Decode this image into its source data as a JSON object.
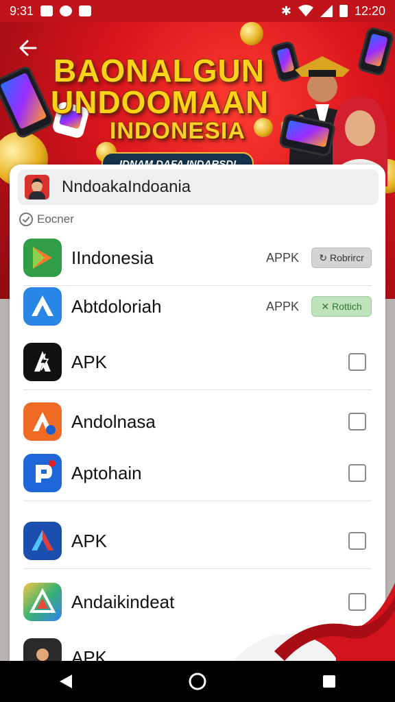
{
  "status_bar": {
    "time": "9:31",
    "clock": "12:20"
  },
  "banner": {
    "title_line1": "BAONALGUN",
    "title_line2": "UNDOOMAAN",
    "title_line3": "INDONESIA",
    "ribbon": "IDNAM DAFA INDARSDI"
  },
  "search": {
    "value": "NndoakaIndoania"
  },
  "section": {
    "label": "Eocner"
  },
  "apps": [
    {
      "name": "IIndonesia",
      "tag": "APPK",
      "action": "Robrircr",
      "action_style": "grey",
      "action_icon": "refresh-icon",
      "icon": "play-store-arrow-icon",
      "icon_color": "#2f9e46"
    },
    {
      "name": "Abtdoloriah",
      "tag": "APPK",
      "action": "Rottich",
      "action_style": "green",
      "action_icon": "close-icon",
      "icon": "triangle-a-icon",
      "icon_color": "#2a86e6"
    },
    {
      "name": "APK",
      "icon": "lightning-a-icon",
      "icon_color": "#111111"
    },
    {
      "name": "Andolnasa",
      "icon": "orange-a-icon",
      "icon_color": "#ef6b24"
    },
    {
      "name": "Aptohain",
      "icon": "p-icon",
      "icon_color": "#1f67d8"
    },
    {
      "name": "APK",
      "icon": "color-a-icon",
      "icon_color": "#1a4fb0"
    },
    {
      "name": "Andaikindeat",
      "icon": "gradient-triangle-icon",
      "icon_color": "#e2b32a"
    },
    {
      "name": "APK",
      "icon": "avatar-icon",
      "icon_color": "#2a2a2a"
    }
  ],
  "colors": {
    "banner_red": "#d8141c",
    "accent_gold": "#ffd21a"
  }
}
